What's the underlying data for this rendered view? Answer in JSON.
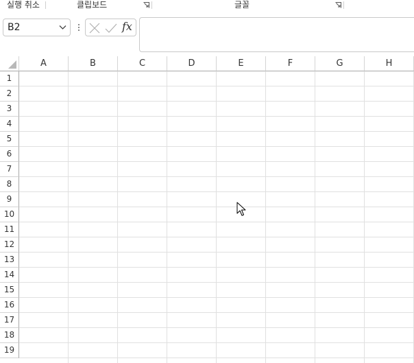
{
  "ribbon": {
    "undo_label": "실행 취소",
    "clipboard_label": "클립보드",
    "font_label": "글꼴"
  },
  "formula_bar": {
    "name_box_value": "B2",
    "fx_label": "fx",
    "formula_value": ""
  },
  "sheet": {
    "columns": [
      "A",
      "B",
      "C",
      "D",
      "E",
      "F",
      "G",
      "H"
    ],
    "rows": [
      "1",
      "2",
      "3",
      "4",
      "5",
      "6",
      "7",
      "8",
      "9",
      "10",
      "11",
      "12",
      "13",
      "14",
      "15",
      "16",
      "17",
      "18",
      "19"
    ]
  },
  "icons": {
    "cancel": "x-icon",
    "enter": "check-icon",
    "dropdown": "chevron-down-icon",
    "launcher": "dialog-launcher-icon",
    "cursor": "mouse-pointer-icon"
  },
  "colors": {
    "header_border": "#a8a8a8",
    "gridline": "#e0e0e0"
  }
}
